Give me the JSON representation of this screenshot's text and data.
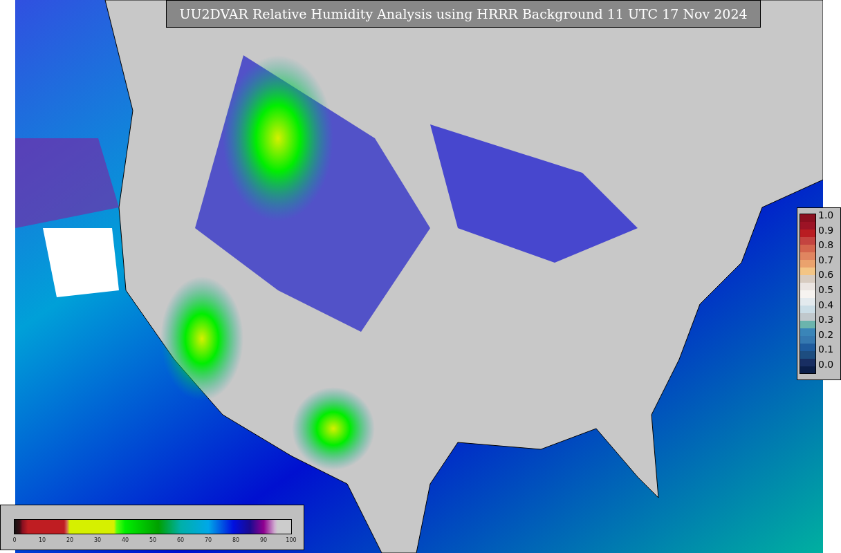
{
  "title": "UU2DVAR Relative Humidity Analysis using HRRR Background 11 UTC 17 Nov 2024",
  "observation_legend": {
    "ticks": [
      "1.0",
      "0.9",
      "0.8",
      "0.7",
      "0.6",
      "0.5",
      "0.4",
      "0.3",
      "0.2",
      "0.1",
      "0.0"
    ]
  },
  "humidity_legend": {
    "ticks": [
      "0",
      "10",
      "20",
      "30",
      "40",
      "50",
      "60",
      "70",
      "80",
      "90",
      "100"
    ]
  }
}
